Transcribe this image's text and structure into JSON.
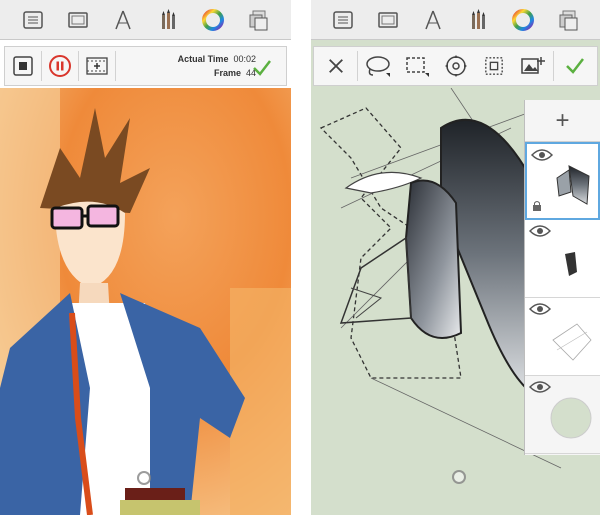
{
  "left_app": {
    "toolbar": {
      "icons": [
        "list-icon",
        "canvas-icon",
        "ruler-icon",
        "brushes-icon",
        "color-wheel-icon",
        "layers-icon"
      ]
    },
    "recording": {
      "actual_time_label": "Actual Time",
      "actual_time_value": "00:02",
      "frame_label": "Frame",
      "frame_value": "44"
    }
  },
  "right_app": {
    "toolbar": {
      "icons": [
        "list-icon",
        "canvas-icon",
        "ruler-icon",
        "brushes-icon",
        "color-wheel-icon",
        "layers-icon"
      ]
    },
    "selection_tools": [
      "close-icon",
      "lasso-icon",
      "rect-select-icon",
      "transform-icon",
      "marquee-icon",
      "image-import-icon",
      "checkmark-icon"
    ],
    "layers": {
      "add_label": "+",
      "count": 4
    }
  },
  "colors": {
    "toolbar_bg": "#ededed",
    "accent_green": "#5bb040",
    "pause_red": "#d9362c",
    "canvas_green": "#d4dfcc"
  }
}
